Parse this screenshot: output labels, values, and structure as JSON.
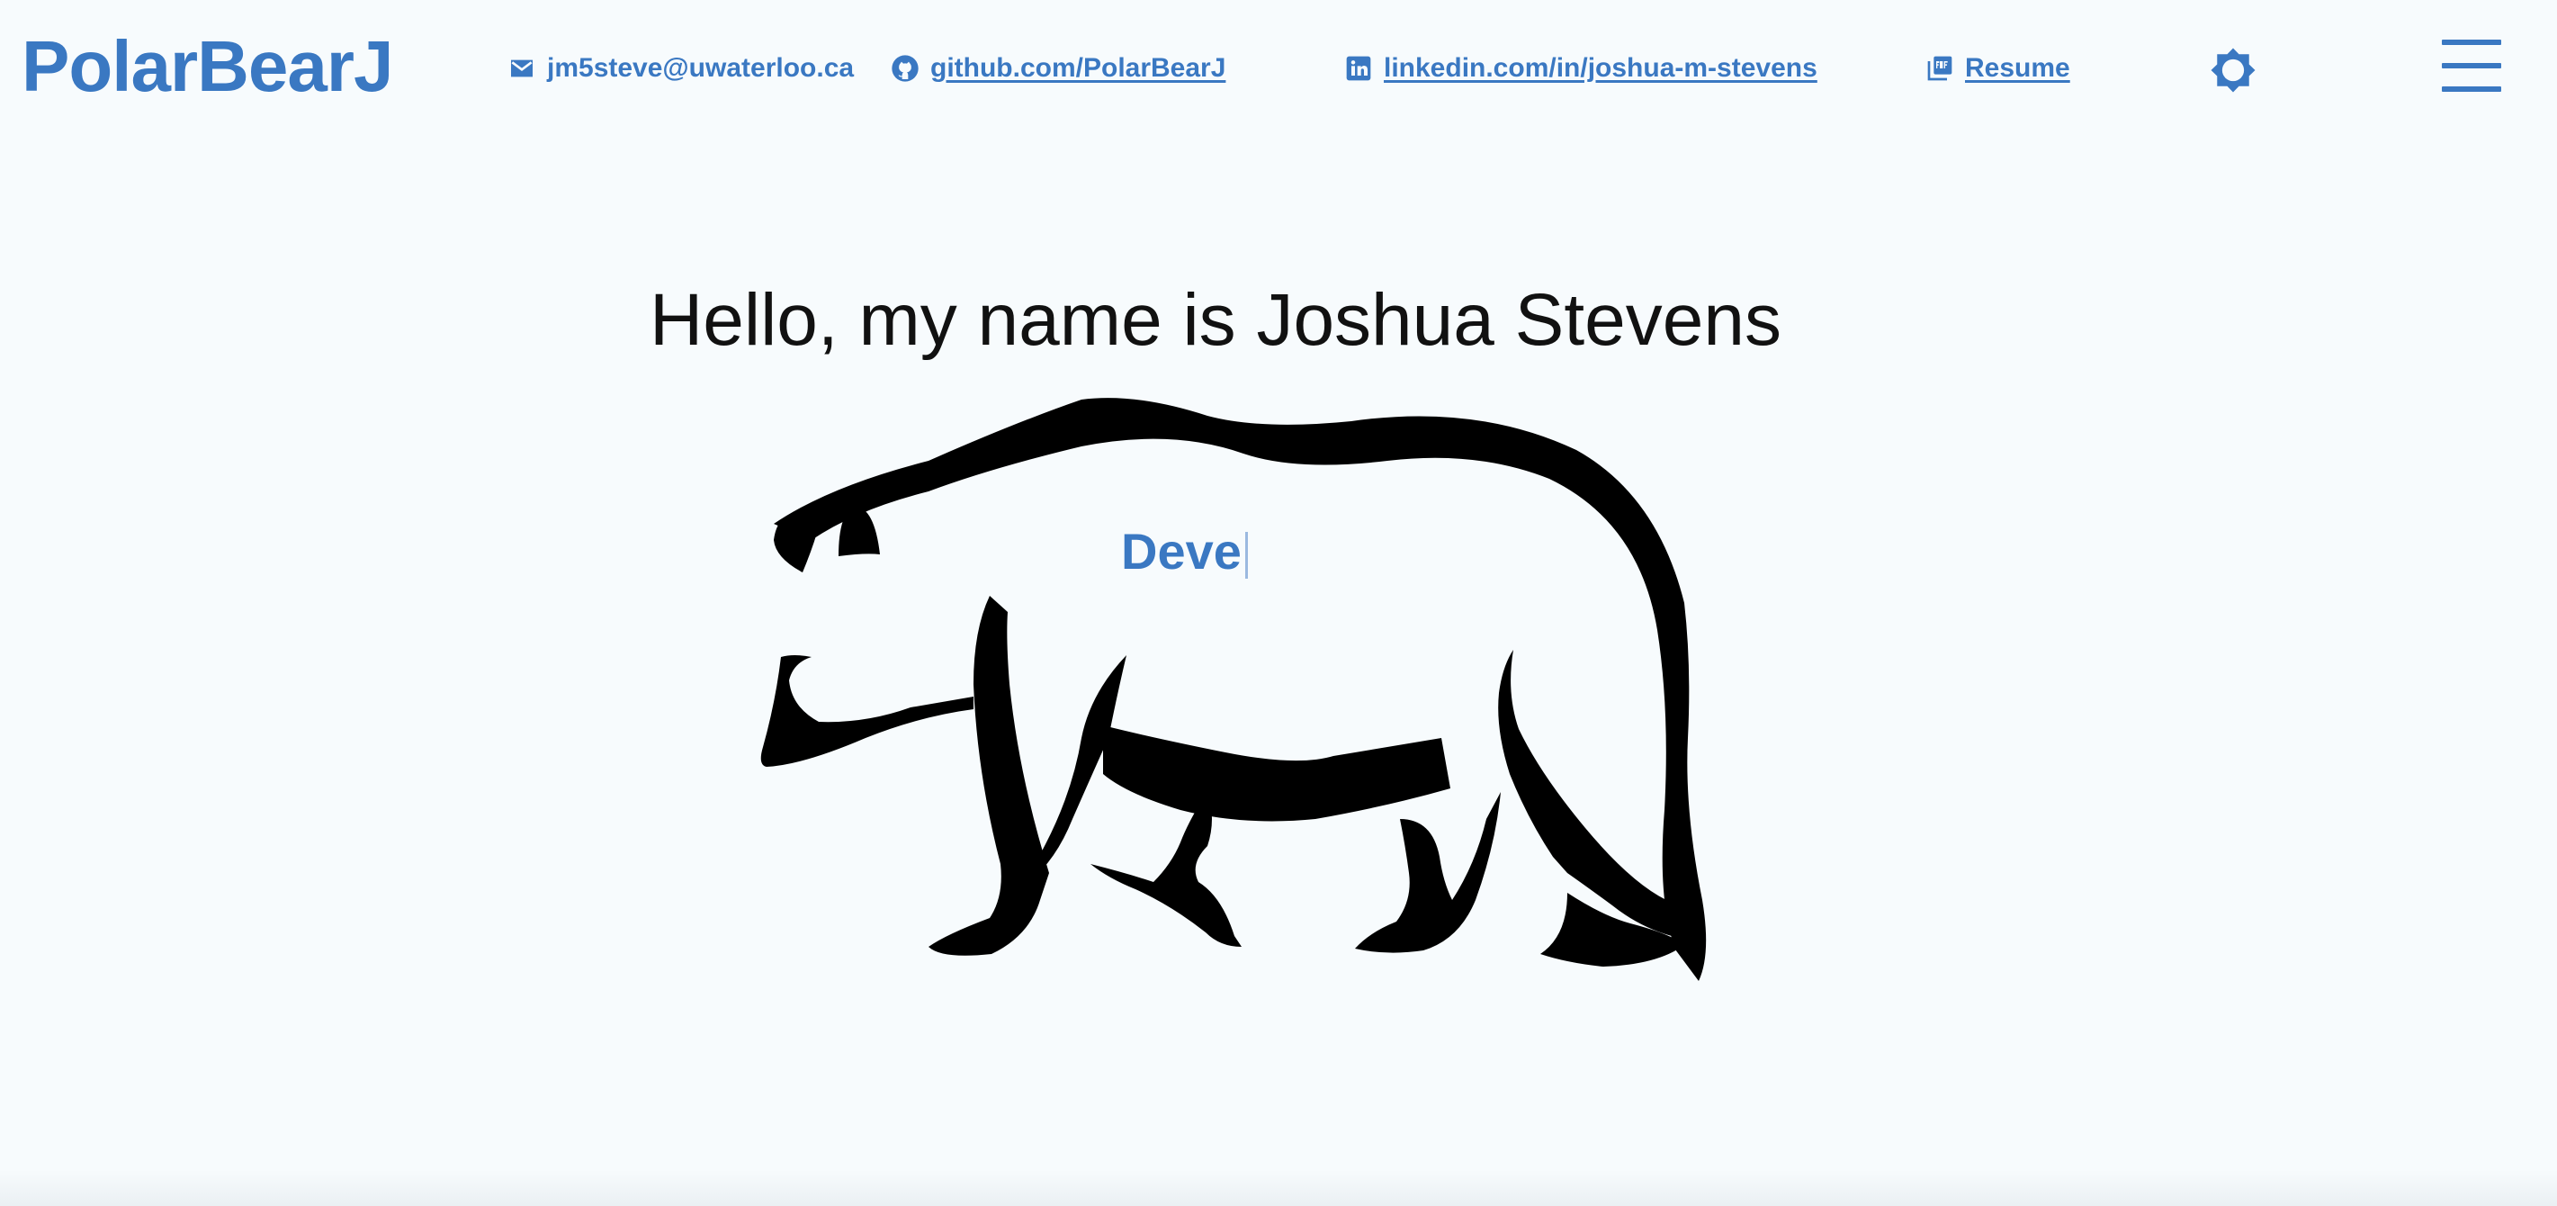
{
  "brand": {
    "name": "PolarBearJ"
  },
  "contacts": {
    "email": {
      "icon": "mail-icon",
      "text": "jm5steve@uwaterloo.ca"
    },
    "github": {
      "icon": "github-icon",
      "text": "github.com/PolarBearJ"
    },
    "linkedin": {
      "icon": "linkedin-icon",
      "text": "linkedin.com/in/joshua-m-stevens"
    },
    "resume": {
      "icon": "pdf-icon",
      "text": "Resume"
    }
  },
  "controls": {
    "theme_icon": "brightness-icon",
    "menu_icon": "hamburger-menu-icon"
  },
  "hero": {
    "title": "Hello, my name is Joshua Stevens",
    "typing_text": "Deve",
    "image": "polar-bear-outline"
  },
  "colors": {
    "accent": "#3a78c2",
    "background": "#f7fbfd",
    "text": "#111111"
  }
}
